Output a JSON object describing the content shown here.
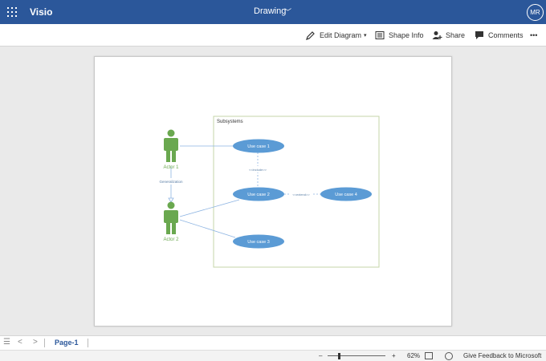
{
  "app": {
    "name": "Visio",
    "document_title": "Drawing",
    "user_initials": "MR"
  },
  "ribbon": {
    "edit_diagram": "Edit Diagram",
    "shape_info": "Shape Info",
    "share": "Share",
    "comments": "Comments",
    "more": "•••"
  },
  "diagram": {
    "container_label": "Subsystems",
    "actors": [
      "Actor 1",
      "Actor 2"
    ],
    "use_cases": [
      "Use case 1",
      "Use case 2",
      "Use case 3",
      "Use case 4"
    ],
    "relations": {
      "generalization": "Generalization",
      "include": "<<include>>",
      "extend": "<<extend>>"
    },
    "colors": {
      "actor": "#6aa84f",
      "use_case": "#5b9bd5",
      "container_border": "#c5d6a8",
      "line": "#8db4e2"
    }
  },
  "tabs": {
    "page": "Page-1"
  },
  "status": {
    "zoom_minus": "–",
    "zoom_plus": "+",
    "zoom": "62%",
    "feedback": "Give Feedback to Microsoft"
  }
}
